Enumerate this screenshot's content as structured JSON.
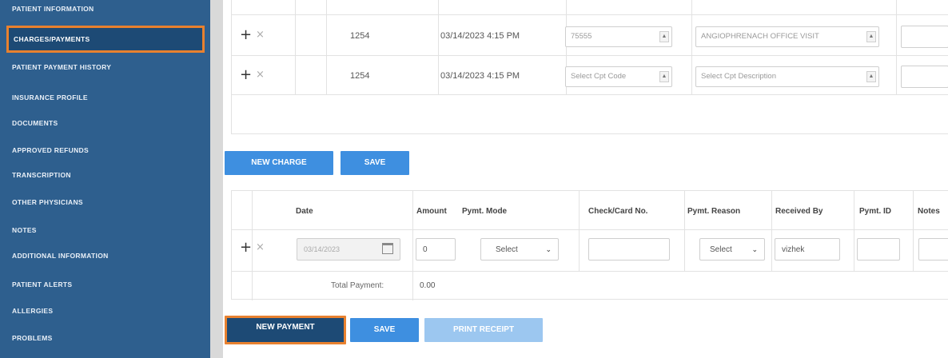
{
  "sidebar": {
    "items": [
      {
        "label": "PATIENT INFORMATION"
      },
      {
        "label": "CHARGES/PAYMENTS"
      },
      {
        "label": "PATIENT PAYMENT HISTORY"
      },
      {
        "label": "INSURANCE PROFILE"
      },
      {
        "label": "DOCUMENTS"
      },
      {
        "label": "APPROVED REFUNDS"
      },
      {
        "label": "TRANSCRIPTION"
      },
      {
        "label": "OTHER PHYSICIANS"
      },
      {
        "label": "NOTES"
      },
      {
        "label": "ADDITIONAL INFORMATION"
      },
      {
        "label": "PATIENT ALERTS"
      },
      {
        "label": "ALLERGIES"
      },
      {
        "label": "PROBLEMS"
      }
    ],
    "active_index": 1,
    "colors": {
      "background": "#2e5f8e",
      "highlight": "#e8812f"
    }
  },
  "charges": {
    "rows": [
      {
        "plus": "+",
        "remove": "×",
        "id": "1254",
        "datetime": "03/14/2023 4:15 PM",
        "cpt_code": "75555",
        "cpt_description": "ANGIOPHRENACH OFFICE VISIT"
      },
      {
        "plus": "+",
        "remove": "×",
        "id": "1254",
        "datetime": "03/14/2023 4:15 PM",
        "cpt_code": "Select Cpt Code",
        "cpt_description": "Select Cpt Description"
      }
    ],
    "buttons": {
      "new_charge": "NEW CHARGE",
      "save": "SAVE"
    }
  },
  "payments": {
    "headers": {
      "date": "Date",
      "amount": "Amount",
      "mode": "Pymt. Mode",
      "check_card": "Check/Card No.",
      "reason": "Pymt. Reason",
      "received_by": "Received By",
      "pymt_id": "Pymt. ID",
      "notes": "Notes"
    },
    "row": {
      "plus": "+",
      "remove": "×",
      "date": "03/14/2023",
      "amount": "0",
      "mode": "Select",
      "check_card": "",
      "reason": "Select",
      "received_by": "vizhek",
      "pymt_id": "",
      "notes": ""
    },
    "total_label": "Total Payment:",
    "total_value": "0.00",
    "buttons": {
      "new_payment": "NEW PAYMENT",
      "save": "SAVE",
      "print_receipt": "PRINT RECEIPT"
    }
  },
  "icons": {
    "calendar": "calendar-icon",
    "dropdown": "chevron-down-icon"
  },
  "colors": {
    "accent": "#3e8fe0",
    "highlight_border": "#e8812f"
  }
}
